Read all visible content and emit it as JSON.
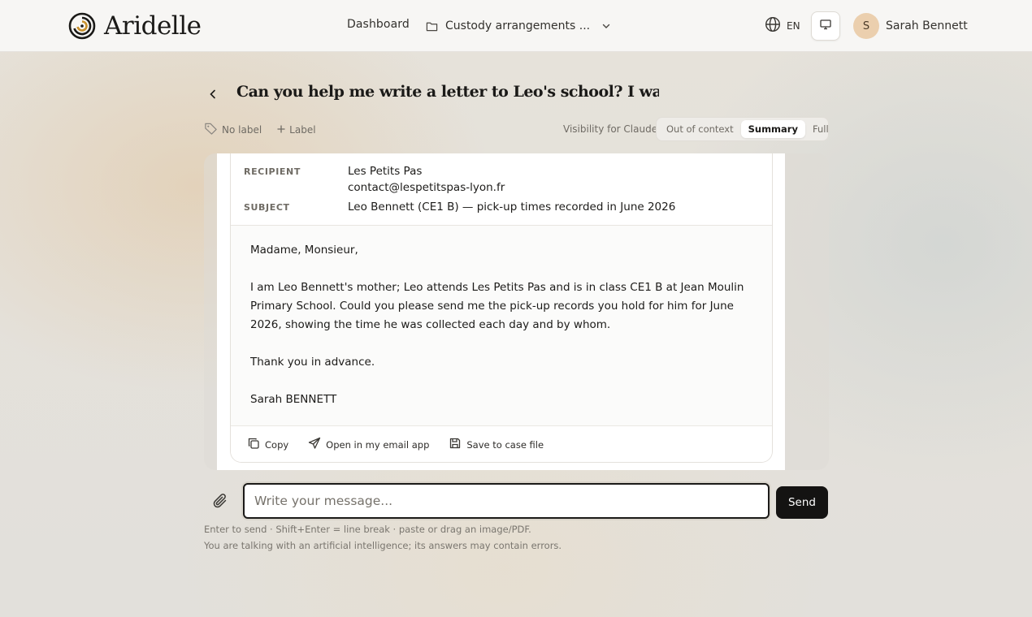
{
  "header": {
    "brand": "Aridelle",
    "nav_dashboard": "Dashboard",
    "case_selector": "Custody arrangements ...",
    "language": "EN",
    "user_initial": "S",
    "user_name": "Sarah Bennett"
  },
  "conversation": {
    "title": "Can you help me write a letter to Leo's school? I want to...",
    "no_label": "No label",
    "add_label": "Label",
    "visibility_label": "Visibility for Claude",
    "visibility_options": [
      "Out of context",
      "Summary",
      "Full"
    ],
    "visibility_selected": "Summary"
  },
  "email": {
    "recipient_label": "RECIPIENT",
    "recipient_name": "Les Petits Pas",
    "recipient_email": "contact@lespetitspas-lyon.fr",
    "subject_label": "SUBJECT",
    "subject": "Leo Bennett (CE1 B) — pick-up times recorded in June 2026",
    "body": [
      "Madame, Monsieur,",
      "I am Leo Bennett's mother; Leo attends Les Petits Pas and is in class CE1 B at Jean Moulin Primary School. Could you please send me the pick-up records you hold for him for June 2026, showing the time he was collected each day and by whom.",
      "Thank you in advance.",
      "Sarah BENNETT"
    ],
    "actions": {
      "copy": "Copy",
      "open_email": "Open in my email app",
      "save_case": "Save to case file"
    }
  },
  "composer": {
    "placeholder": "Write your message...",
    "send": "Send",
    "hint": "Enter to send · Shift+Enter = line break · paste or drag an image/PDF.",
    "disclaimer": "You are talking with an artificial intelligence; its answers may contain errors."
  },
  "icons": {
    "logo": "spiral-logo-icon",
    "folder": "folder-icon",
    "chevron": "chevron-down-icon",
    "globe": "globe-icon",
    "monitor": "monitor-icon",
    "back": "chevron-left-icon",
    "tag": "tag-icon",
    "plus": "plus-icon",
    "copy": "copy-icon",
    "send": "send-icon",
    "save": "save-icon",
    "paperclip": "paperclip-icon"
  },
  "colors": {
    "primary_dark": "#141312",
    "avatar_bg": "#ebcfae",
    "accent_logo": "#c8902c"
  }
}
